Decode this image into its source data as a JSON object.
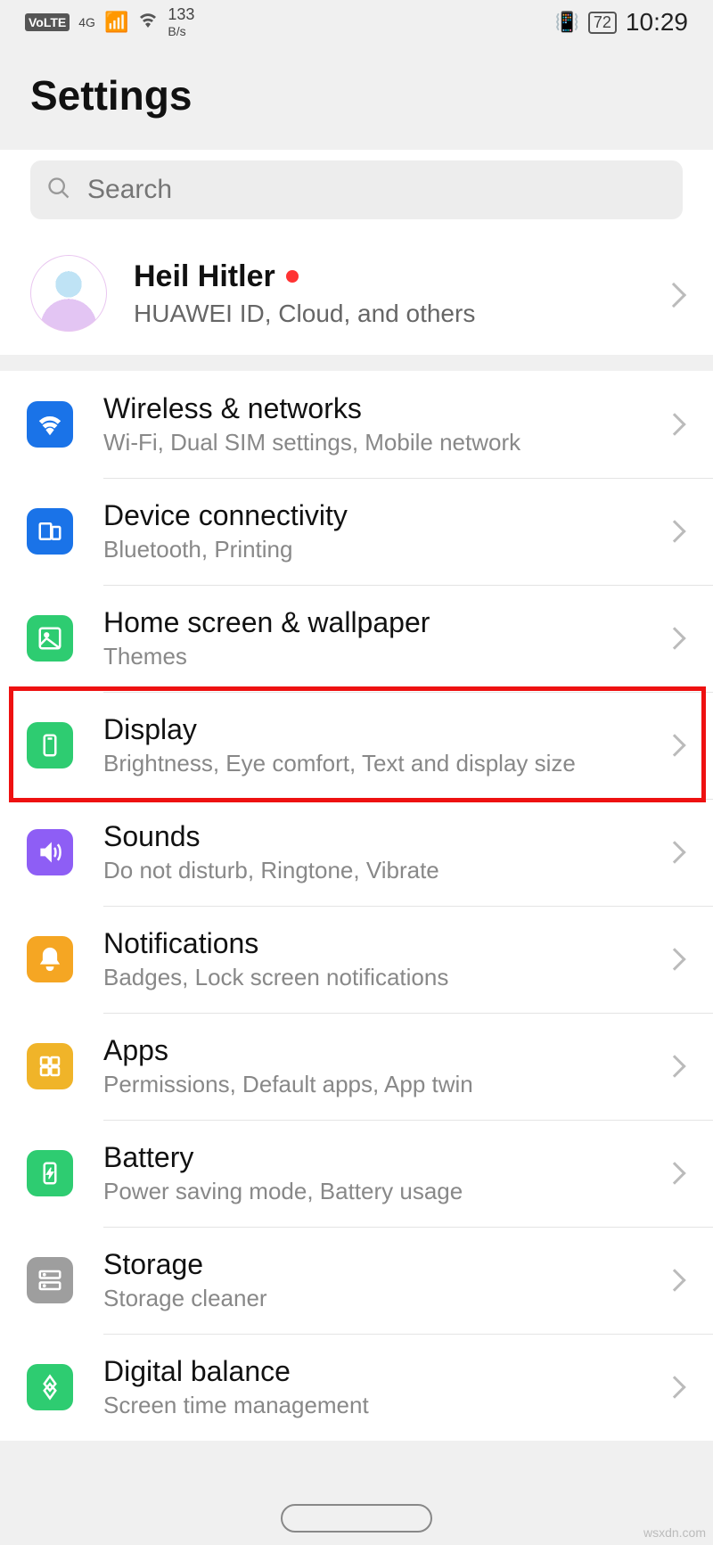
{
  "status": {
    "volte": "VoLTE",
    "net": "4G",
    "speed_num": "133",
    "speed_unit": "B/s",
    "battery": "72",
    "time": "10:29"
  },
  "page": {
    "title": "Settings"
  },
  "search": {
    "placeholder": "Search"
  },
  "account": {
    "name": "Heil Hitler",
    "sub": "HUAWEI ID, Cloud, and others"
  },
  "items": [
    {
      "id": "wireless",
      "title": "Wireless & networks",
      "sub": "Wi-Fi, Dual SIM settings, Mobile network",
      "color": "c-blue"
    },
    {
      "id": "device-conn",
      "title": "Device connectivity",
      "sub": "Bluetooth, Printing",
      "color": "c-blue"
    },
    {
      "id": "home-wall",
      "title": "Home screen & wallpaper",
      "sub": "Themes",
      "color": "c-green"
    },
    {
      "id": "display",
      "title": "Display",
      "sub": "Brightness, Eye comfort, Text and display size",
      "color": "c-green",
      "highlighted": true
    },
    {
      "id": "sounds",
      "title": "Sounds",
      "sub": "Do not disturb, Ringtone, Vibrate",
      "color": "c-purple"
    },
    {
      "id": "notifications",
      "title": "Notifications",
      "sub": "Badges, Lock screen notifications",
      "color": "c-orange"
    },
    {
      "id": "apps",
      "title": "Apps",
      "sub": "Permissions, Default apps, App twin",
      "color": "c-gold"
    },
    {
      "id": "battery",
      "title": "Battery",
      "sub": "Power saving mode, Battery usage",
      "color": "c-green"
    },
    {
      "id": "storage",
      "title": "Storage",
      "sub": "Storage cleaner",
      "color": "c-gray"
    },
    {
      "id": "digital",
      "title": "Digital balance",
      "sub": "Screen time management",
      "color": "c-green"
    }
  ],
  "watermark": "wsxdn.com"
}
